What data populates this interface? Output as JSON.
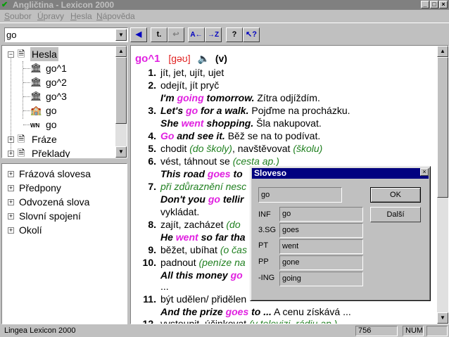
{
  "window": {
    "title": "Angličtina - Lexicon 2000"
  },
  "menu": [
    {
      "label": "Soubor",
      "underline": "S",
      "rest": "oubor"
    },
    {
      "label": "Úpravy",
      "underline": "Ú",
      "rest": "pravy"
    },
    {
      "label": "Hesla",
      "underline": "H",
      "rest": "esla"
    },
    {
      "label": "Nápověda",
      "underline": "N",
      "rest": "ápověda"
    }
  ],
  "search": {
    "value": "go"
  },
  "tree": {
    "root": "Hesla",
    "items": [
      "go^1",
      "go^2",
      "go^3",
      "go",
      "go"
    ],
    "others": [
      "Fráze",
      "Překlady"
    ]
  },
  "categories": [
    "Frázová slovesa",
    "Předpony",
    "Odvozená slova",
    "Slovní spojení",
    "Okolí"
  ],
  "entry": {
    "headword": "go^1",
    "pron": "[gəʊ]",
    "pos": "(v)",
    "lines": {
      "n1": "1.",
      "l1": "jít, jet, ujít, ujet",
      "n2": "2.",
      "l2": "odejít, jít pryč",
      "l2a_ex1": "I'm ",
      "l2a_mag": "going",
      "l2a_ex2": " tomorrow.",
      "l2a_tr": "  Zítra odjíždím.",
      "n3": "3.",
      "l3_ex1": "Let's ",
      "l3_mag": "go",
      "l3_ex2": " for a walk.",
      "l3_tr": "  Pojďme na procházku.",
      "l3a_ex1": "She ",
      "l3a_mag": "went",
      "l3a_ex2": " shopping.",
      "l3a_tr": "  Šla nakupovat.",
      "n4": "4.",
      "l4_mag": "Go",
      "l4_ex": " and see it.",
      "l4_tr": "  Běž se na to podívat.",
      "n5": "5.",
      "l5_a": "chodit ",
      "l5_g1": "(do školy)",
      "l5_b": ", navštěvovat ",
      "l5_g2": "(školu)",
      "n6": "6.",
      "l6_a": "vést, táhnout se ",
      "l6_g": "(cesta ap.)",
      "l6a_ex1": "This road ",
      "l6a_mag": "goes",
      "l6a_ex2": " to",
      "n7": "7.",
      "l7_g": "při zdůraznění nesc",
      "l7a_ex1": "Don't you ",
      "l7a_mag": "go",
      "l7a_ex2": " tellir",
      "l7b": "vykládat.",
      "n8": "8.",
      "l8_a": "zajít, zacházet ",
      "l8_g": "(do",
      "l8a_ex1": "He ",
      "l8a_mag": "went",
      "l8a_ex2": " so far tha",
      "n9": "9.",
      "l9_a": "běžet, ubíhat ",
      "l9_g": "(o čas",
      "n10": "10.",
      "l10_a": "padnout ",
      "l10_g": "(peníze na",
      "l10a_ex1": "All this money ",
      "l10a_mag": "go",
      "l10b": "...",
      "n11": "11.",
      "l11_a": "být udělen/ přidělen",
      "l11a_ex1": "And the prize ",
      "l11a_mag": "goes",
      "l11a_ex2": " to ...",
      "l11a_tr": "  A cenu získává ...",
      "n12": "12.",
      "l12_a": "vystoupit, účinkovat ",
      "l12_g": "(v televizi, rádiu ap.)"
    }
  },
  "dialog": {
    "title": "Sloveso",
    "word": "go",
    "ok": "OK",
    "next": "Další",
    "forms": [
      {
        "label": "INF",
        "value": "go"
      },
      {
        "label": "3.SG",
        "value": "goes"
      },
      {
        "label": "PT",
        "value": "went"
      },
      {
        "label": "PP",
        "value": "gone"
      },
      {
        "label": "-ING",
        "value": "going"
      }
    ]
  },
  "status": {
    "app": "Lingea Lexicon 2000",
    "count": "756",
    "num": "NUM"
  },
  "colors": {
    "headword": "#e020e0",
    "pron": "#e02020",
    "note": "#208020",
    "dialog_title": "#000080"
  },
  "icons": [
    "app-icon",
    "bookmark-icon",
    "up-icon",
    "forward-icon",
    "from-back-icon",
    "to-back-icon",
    "help-icon",
    "context-help-icon",
    "speaker-icon",
    "document-icon",
    "building-icon",
    "wn-icon"
  ]
}
